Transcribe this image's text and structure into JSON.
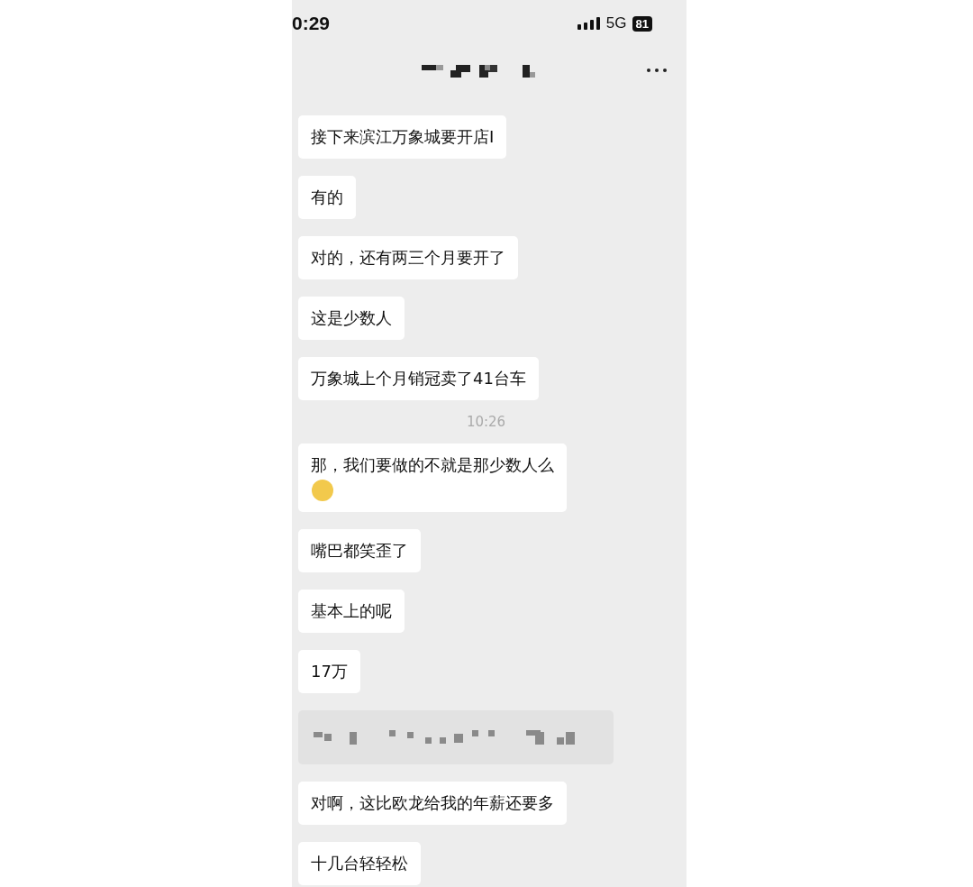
{
  "status_bar": {
    "time": "0:29",
    "network": "5G",
    "battery": "81"
  },
  "header": {
    "title_redacted": true
  },
  "messages": [
    {
      "kind": "text",
      "text": "接下来滨江万象城要开店I"
    },
    {
      "kind": "text",
      "text": "有的"
    },
    {
      "kind": "text",
      "text": "对的，还有两三个月要开了"
    },
    {
      "kind": "text",
      "text": "这是少数人"
    },
    {
      "kind": "text",
      "text": "万象城上个月销冠卖了41台车"
    },
    {
      "kind": "time",
      "text": "10:26"
    },
    {
      "kind": "text",
      "text": "那，我们要做的不就是那少数人么",
      "emoji": true
    },
    {
      "kind": "text",
      "text": "嘴巴都笑歪了"
    },
    {
      "kind": "text",
      "text": "基本上的呢"
    },
    {
      "kind": "text",
      "text": "17万"
    },
    {
      "kind": "redacted"
    },
    {
      "kind": "text",
      "text": "对啊，这比欧龙给我的年薪还要多"
    },
    {
      "kind": "text",
      "text": "十几台轻轻松"
    }
  ]
}
